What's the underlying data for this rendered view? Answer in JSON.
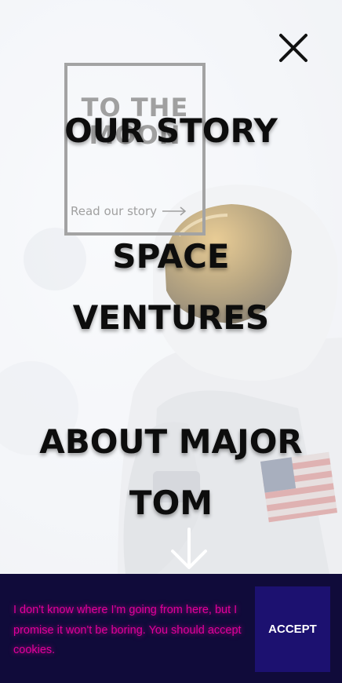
{
  "feature": {
    "title_line1": "TO THE",
    "title_line2": "MOON",
    "link_label": "Read our story",
    "link_icon": "arrow-right-icon"
  },
  "menu": {
    "close_icon": "close-icon",
    "items": [
      {
        "label_line1": "OUR STORY",
        "label_line2": ""
      },
      {
        "label_line1": "SPACE",
        "label_line2": "VENTURES"
      },
      {
        "label_line1": "ABOUT MAJOR",
        "label_line2": "TOM"
      }
    ],
    "scroll_icon": "arrow-down-icon"
  },
  "cookie": {
    "message": "I don't know where I'm going from here, but I promise it won't be boring. You should accept cookies.",
    "accept_label": "ACCEPT"
  },
  "colors": {
    "cookie_bg": "#100b3a",
    "cookie_text": "#e0009a",
    "accept_bg": "#1c1170",
    "menu_text": "#0d0d0d"
  }
}
